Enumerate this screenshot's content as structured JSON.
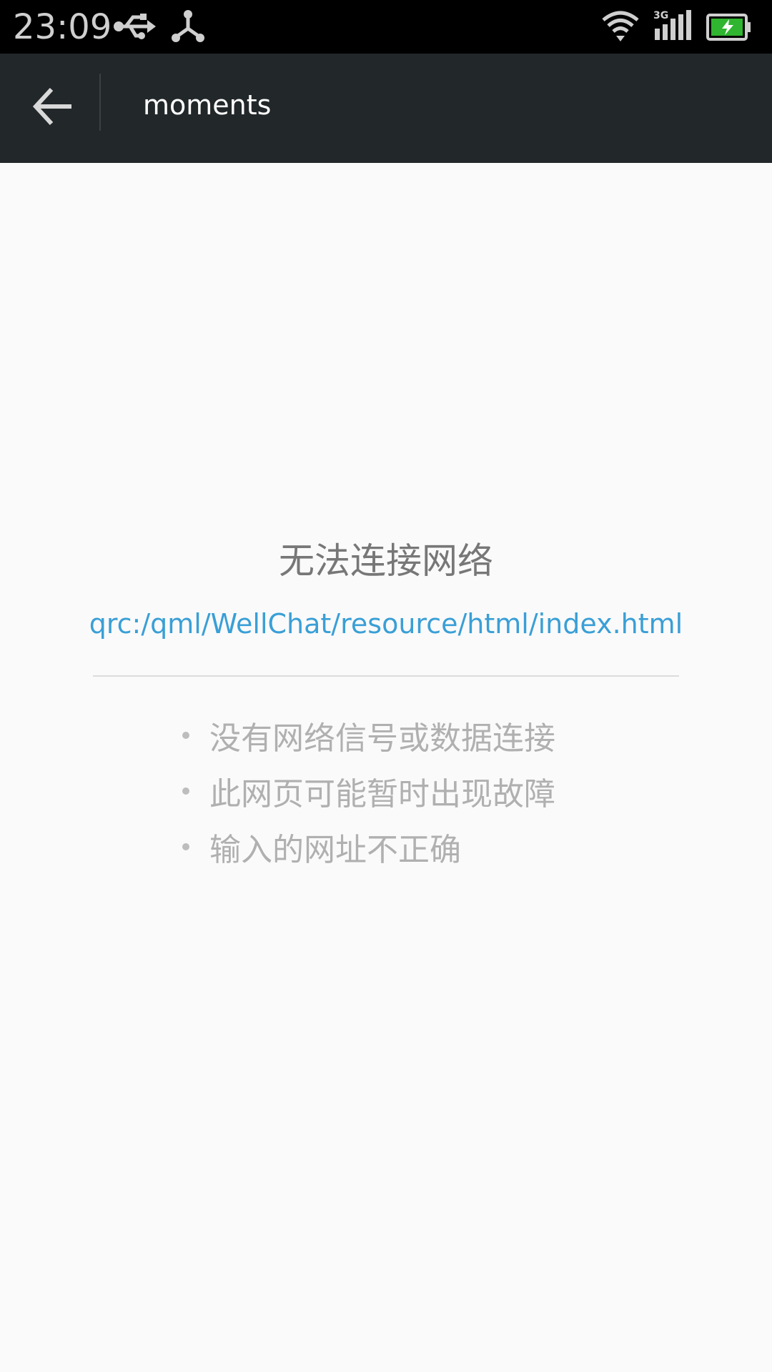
{
  "status_bar": {
    "time": "23:09",
    "icons": [
      "usb-icon",
      "share-icon",
      "wifi-icon",
      "signal-3g-icon",
      "battery-charging-icon"
    ],
    "network_type": "3G",
    "battery_color": "#2fb52f"
  },
  "app_bar": {
    "title": "moments",
    "back_icon": "arrow-left-icon"
  },
  "error_page": {
    "title": "无法连接网络",
    "url": "qrc:/qml/WellChat/resource/html/index.html",
    "reasons": [
      "没有网络信号或数据连接",
      "此网页可能暂时出现故障",
      "输入的网址不正确"
    ]
  },
  "colors": {
    "app_bar_bg": "#22272a",
    "link": "#3a9fd6",
    "background": "#fafafa"
  }
}
